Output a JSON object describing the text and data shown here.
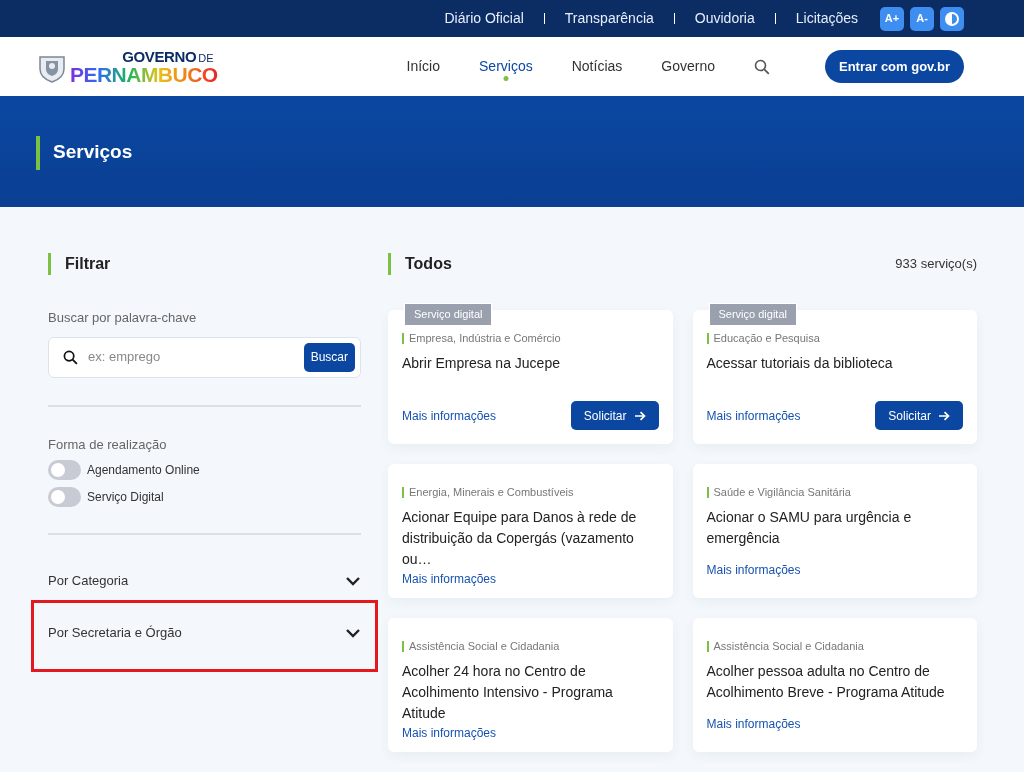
{
  "top_bar": {
    "links": [
      "Diário Oficial",
      "Transparência",
      "Ouvidoria",
      "Licitações"
    ],
    "buttons": [
      {
        "kind": "text",
        "label": "A+"
      },
      {
        "kind": "text",
        "label": "A-"
      },
      {
        "kind": "contrast"
      }
    ]
  },
  "header": {
    "logo": {
      "top": "GOVERNO",
      "de": "DE",
      "bottom": "PERNAMBUCO"
    },
    "nav": [
      {
        "label": "Início",
        "selected": false
      },
      {
        "label": "Serviços",
        "selected": true
      },
      {
        "label": "Notícias",
        "selected": false
      },
      {
        "label": "Governo",
        "selected": false
      }
    ],
    "login_button": "Entrar com gov.br"
  },
  "hero": {
    "title": "Serviços"
  },
  "filters": {
    "title": "Filtrar",
    "search_label": "Buscar por palavra-chave",
    "search": {
      "placeholder": "ex: emprego",
      "button": "Buscar"
    },
    "mode_label": "Forma de realização",
    "toggles": [
      {
        "label": "Agendamento Online",
        "on": false
      },
      {
        "label": "Serviço Digital",
        "on": false
      }
    ],
    "accordions": [
      {
        "label": "Por Categoria",
        "expanded": false,
        "highlighted": false
      },
      {
        "label": "Por Secretaria e Órgão",
        "expanded": false,
        "highlighted": true
      }
    ]
  },
  "results": {
    "title": "Todos",
    "count": "933 serviço(s)",
    "cards": [
      {
        "tag": "Serviço digital",
        "category": "Empresa, Indústria e Comércio",
        "title": "Abrir Empresa na Jucepe",
        "link": "Mais informações",
        "button": "Solicitar"
      },
      {
        "tag": "Serviço digital",
        "category": "Educação e Pesquisa",
        "title": "Acessar tutoriais da biblioteca",
        "link": "Mais informações",
        "button": "Solicitar"
      },
      {
        "category": "Energia, Minerais e Combustíveis",
        "title": "Acionar Equipe para Danos à rede de distribuição da Copergás (vazamento ou…",
        "link": "Mais informações"
      },
      {
        "category": "Saúde e Vigilância Sanitária",
        "title": "Acionar o SAMU para urgência e emergência",
        "link": "Mais informações"
      },
      {
        "category": "Assistência Social e Cidadania",
        "title": "Acolher 24 hora no Centro de Acolhimento Intensivo - Programa Atitude",
        "link": "Mais informações"
      },
      {
        "category": "Assistência Social e Cidadania",
        "title": "Acolher pessoa adulta no Centro de Acolhimento Breve - Programa Atitude",
        "link": "Mais informações"
      }
    ]
  }
}
